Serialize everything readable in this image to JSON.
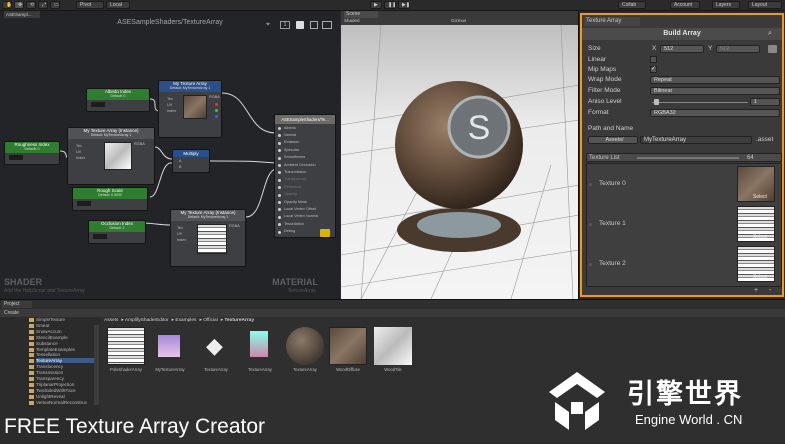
{
  "toolbar": {
    "items": [
      "Pivot",
      "Local",
      "Collab",
      "Account",
      "Layers",
      "Layout"
    ]
  },
  "graph": {
    "tab": "ASESampl...",
    "title": "ASESampleShaders/TextureArray",
    "footer_left": "SHADER",
    "footer_left_sub": "Add the HelpScript and TextureArray",
    "footer_right": "MATERIAL",
    "footer_right_sub": "TextureArray",
    "nodes": {
      "albedo": {
        "title": "Albedo Index",
        "sub": "Default: 0"
      },
      "my_tex_top": {
        "title": "My Texture Array",
        "sub": "Default: MyTextureArray 1",
        "ports": [
          "Tex",
          "UV",
          "Index"
        ],
        "outs": [
          "RGBA"
        ]
      },
      "roughness": {
        "title": "Roughness Index",
        "sub": "Default: 0"
      },
      "my_tex_instance": {
        "title": "My Texture Array (Instance)",
        "sub": "Default: MyTextureArray 1",
        "ports": [
          "Tex",
          "UV",
          "Index"
        ],
        "outs": [
          "RGBA"
        ]
      },
      "multiply": {
        "title": "Multiply",
        "ports": [
          "A",
          "B"
        ]
      },
      "rough_scale": {
        "title": "Rough Scale",
        "sub": "Default: 0.5000"
      },
      "occlusion": {
        "title": "Occlusion Index",
        "sub": "Default: 2"
      },
      "my_tex_instance2": {
        "title": "My Texture Array (Instance)",
        "sub": "Default: MyTextureArray 1",
        "ports": [
          "Tex",
          "UV",
          "Index"
        ],
        "outs": [
          "RGBA"
        ]
      },
      "output": {
        "title": "ASESampleShaders/Te...",
        "ports": [
          "Albedo",
          "Normal",
          "Emission",
          "Specular",
          "Smoothness",
          "Ambient Occlusion",
          "Transmission",
          "Translucency",
          "Refraction",
          "Opacity",
          "Opacity Mask",
          "Local Vertex Offset",
          "Local Vertex Normal",
          "Tessellation",
          "Debug"
        ]
      }
    }
  },
  "scene": {
    "tab": "Scene",
    "shading": "Shaded",
    "gizmos": "Gizmos"
  },
  "inspector": {
    "tab": "Texture Array",
    "build_button": "Build Array",
    "size_label": "Size",
    "size_x_label": "X",
    "size_x": "512",
    "size_y_label": "Y",
    "size_y": "512",
    "linear_label": "Linear",
    "mipmaps_label": "Mip Maps",
    "wrap_label": "Wrap Mode",
    "wrap_value": "Repeat",
    "filter_label": "Filter Mode",
    "filter_value": "Bilinear",
    "aniso_label": "Aniso Level",
    "aniso_value": "1",
    "format_label": "Format",
    "format_value": "RGBA32",
    "path_label": "Path and Name",
    "path_button": "Assets/",
    "path_value": "MyTextureArray",
    "path_ext": ".asset",
    "list_label": "Texture List",
    "list_count": "64",
    "textures": [
      {
        "label": "Texture 0",
        "select": "Select"
      },
      {
        "label": "Texture 1",
        "select": "Select"
      },
      {
        "label": "Texture 2",
        "select": "Select"
      }
    ],
    "add_btn": "+",
    "remove_btn": "-"
  },
  "project": {
    "tab": "Project",
    "create": "Create",
    "breadcrumb": [
      "Assets",
      "AmplifyShaderEditor",
      "Examples",
      "Official",
      "TextureArray"
    ],
    "tree": [
      "SimpleTexture",
      "Smear",
      "SnowAccum",
      "StencilExample",
      "Substance",
      "TemplateExamples",
      "Tessellation",
      "TextureArray",
      "Translucency",
      "Transmission",
      "Transparency",
      "TriplanarProjection",
      "TwoSidedWithFace",
      "UnlightReveal",
      "VertexNormalReconstruc"
    ],
    "assets": [
      "PoleShaderArray",
      "MyTextureArray",
      "TextureArray",
      "TextureArray",
      "TextureArray",
      "WoodDiffuse",
      "WoodTile"
    ]
  },
  "caption": "FREE Texture Array Creator",
  "watermark": {
    "cn": "引擎世界",
    "en": "Engine World . CN"
  },
  "colors": {
    "accent": "#f09a1a",
    "node_green": "#2f7d2f",
    "node_blue": "#2b4f8a"
  }
}
